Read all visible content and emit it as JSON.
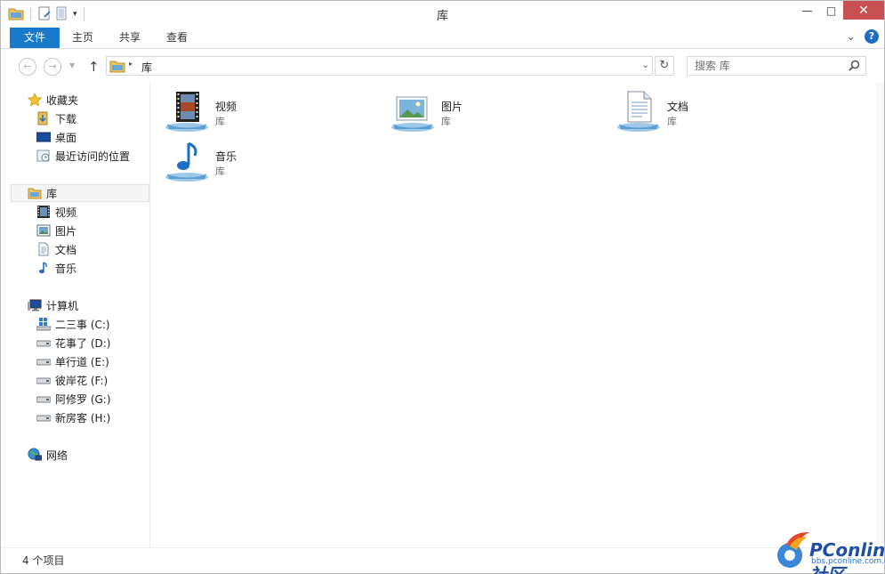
{
  "window": {
    "title": "库"
  },
  "quick_access": {
    "icons": [
      "folder-icon",
      "properties-icon",
      "new-folder-icon",
      "customize-dropdown-icon"
    ]
  },
  "window_controls": {
    "minimize": "—",
    "maximize": "□",
    "close": "✕"
  },
  "ribbon": {
    "tabs": [
      {
        "label": "文件",
        "active": true
      },
      {
        "label": "主页"
      },
      {
        "label": "共享"
      },
      {
        "label": "查看"
      }
    ],
    "expand": "⌄",
    "help": "?"
  },
  "address_bar": {
    "back": "←",
    "forward": "→",
    "up": "↑",
    "crumb_arrow": "▸",
    "path": "库",
    "dropdown": "⌄",
    "refresh": "↻"
  },
  "search": {
    "placeholder": "搜索 库"
  },
  "nav_pane": {
    "favorites": {
      "label": "收藏夹",
      "items": [
        {
          "label": "下载",
          "icon": "download-folder-icon"
        },
        {
          "label": "桌面",
          "icon": "desktop-icon"
        },
        {
          "label": "最近访问的位置",
          "icon": "recent-places-icon"
        }
      ]
    },
    "libraries": {
      "label": "库",
      "items": [
        {
          "label": "视频",
          "icon": "video-icon"
        },
        {
          "label": "图片",
          "icon": "picture-icon"
        },
        {
          "label": "文档",
          "icon": "document-icon"
        },
        {
          "label": "音乐",
          "icon": "music-icon"
        }
      ]
    },
    "computer": {
      "label": "计算机",
      "items": [
        {
          "label": "二三事 (C:)",
          "icon": "windows-drive-icon"
        },
        {
          "label": "花事了 (D:)",
          "icon": "drive-icon"
        },
        {
          "label": "单行道 (E:)",
          "icon": "drive-icon"
        },
        {
          "label": "彼岸花 (F:)",
          "icon": "drive-icon"
        },
        {
          "label": "阿修罗 (G:)",
          "icon": "drive-icon"
        },
        {
          "label": "新房客 (H:)",
          "icon": "drive-icon"
        }
      ]
    },
    "network": {
      "label": "网络"
    }
  },
  "content": {
    "libraries": [
      {
        "name": "视频",
        "type": "库",
        "icon": "video-library-icon"
      },
      {
        "name": "图片",
        "type": "库",
        "icon": "picture-library-icon"
      },
      {
        "name": "文档",
        "type": "库",
        "icon": "document-library-icon"
      },
      {
        "name": "音乐",
        "type": "库",
        "icon": "music-library-icon"
      }
    ]
  },
  "status_bar": {
    "item_count": "4 个项目"
  },
  "watermark": {
    "logo_text": "PConline社区",
    "sub_text": "bbs.pconline.com.cn"
  },
  "colors": {
    "accent": "#1979ca",
    "close": "#c75050",
    "selection": "#f5f5f5"
  }
}
